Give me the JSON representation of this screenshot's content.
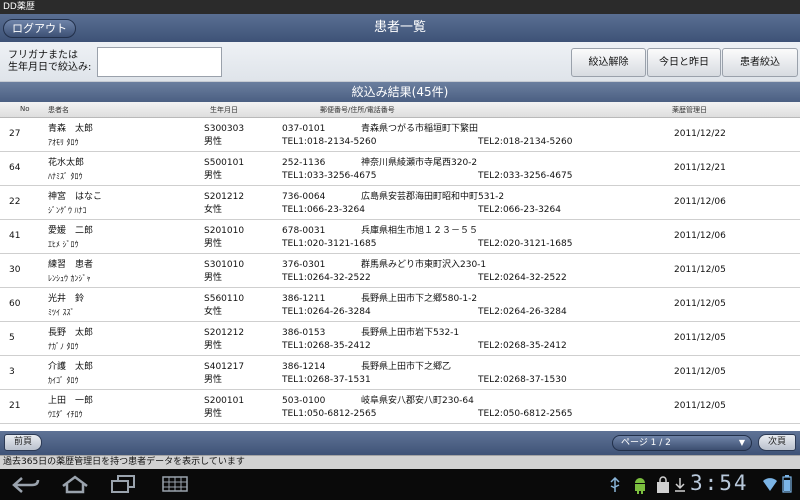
{
  "app": {
    "title": "DD薬歴"
  },
  "header": {
    "logout_label": "ログアウト",
    "title": "患者一覧"
  },
  "filter": {
    "label_line1": "フリガナまたは",
    "label_line2": "生年月日で絞込み:",
    "input_value": "",
    "clear_label": "絞込解除",
    "today_label": "今日と昨日",
    "filter_label": "患者絞込"
  },
  "result": {
    "title": "絞込み結果(45件)"
  },
  "columns": {
    "no": "No",
    "name": "患者名",
    "birth": "生年月日",
    "address": "郵便番号/住所/電話番号",
    "date": "薬歴管理日"
  },
  "patients": [
    {
      "no": "27",
      "name": "青森　太郎",
      "kana": "ｱｵﾓﾘ ﾀﾛｳ",
      "birth": "S300303",
      "sex": "男性",
      "zip": "037-0101",
      "address": "青森県つがる市稲垣町下繁田",
      "tel1": "TEL1:018-2134-5260",
      "tel2": "TEL2:018-2134-5260",
      "date": "2011/12/22"
    },
    {
      "no": "64",
      "name": "花水太郎",
      "kana": "ﾊﾅﾐｽﾞ ﾀﾛｳ",
      "birth": "S500101",
      "sex": "男性",
      "zip": "252-1136",
      "address": "神奈川県綾瀬市寺尾西320-2",
      "tel1": "TEL1:033-3256-4675",
      "tel2": "TEL2:033-3256-4675",
      "date": "2011/12/21"
    },
    {
      "no": "22",
      "name": "神宮　はなこ",
      "kana": "ｼﾞﾝｸﾞｳ ﾊﾅｺ",
      "birth": "S201212",
      "sex": "女性",
      "zip": "736-0064",
      "address": "広島県安芸郡海田町昭和中町531-2",
      "tel1": "TEL1:066-23-3264",
      "tel2": "TEL2:066-23-3264",
      "date": "2011/12/06"
    },
    {
      "no": "41",
      "name": "愛媛　二郎",
      "kana": "ｴﾋﾒ ｼﾞﾛｳ",
      "birth": "S201010",
      "sex": "男性",
      "zip": "678-0031",
      "address": "兵庫県相生市旭１２３－５５",
      "tel1": "TEL1:020-3121-1685",
      "tel2": "TEL2:020-3121-1685",
      "date": "2011/12/06"
    },
    {
      "no": "30",
      "name": "練習　患者",
      "kana": "ﾚﾝｼｭｳ ｶﾝｼﾞｬ",
      "birth": "S301010",
      "sex": "男性",
      "zip": "376-0301",
      "address": "群馬県みどり市東町沢入230-1",
      "tel1": "TEL1:0264-32-2522",
      "tel2": "TEL2:0264-32-2522",
      "date": "2011/12/05"
    },
    {
      "no": "60",
      "name": "光井　鈴",
      "kana": "ﾐﾂｲ ｽｽﾞ",
      "birth": "S560110",
      "sex": "女性",
      "zip": "386-1211",
      "address": "長野県上田市下之郷580-1-2",
      "tel1": "TEL1:0264-26-3284",
      "tel2": "TEL2:0264-26-3284",
      "date": "2011/12/05"
    },
    {
      "no": "5",
      "name": "長野　太郎",
      "kana": "ﾅｶﾞﾉ ﾀﾛｳ",
      "birth": "S201212",
      "sex": "男性",
      "zip": "386-0153",
      "address": "長野県上田市岩下532-1",
      "tel1": "TEL1:0268-35-2412",
      "tel2": "TEL2:0268-35-2412",
      "date": "2011/12/05"
    },
    {
      "no": "3",
      "name": "介護　太郎",
      "kana": "ｶｲｺﾞ ﾀﾛｳ",
      "birth": "S401217",
      "sex": "男性",
      "zip": "386-1214",
      "address": "長野県上田市下之郷乙",
      "tel1": "TEL1:0268-37-1531",
      "tel2": "TEL2:0268-37-1530",
      "date": "2011/12/05"
    },
    {
      "no": "21",
      "name": "上田　一郎",
      "kana": "ｳｴﾀﾞ ｲﾁﾛｳ",
      "birth": "S200101",
      "sex": "男性",
      "zip": "503-0100",
      "address": "岐阜県安八郡安八町230-64",
      "tel1": "TEL1:050-6812-2565",
      "tel2": "TEL2:050-6812-2565",
      "date": "2011/12/05"
    }
  ],
  "pager": {
    "prev_label": "前頁",
    "page_label": "ページ 1 / 2",
    "next_label": "次頁"
  },
  "status": {
    "text": "過去365日の薬歴管理日を持つ患者データを表示しています"
  },
  "system": {
    "clock": "3:54",
    "icons": [
      "back-icon",
      "home-icon",
      "recent-apps-icon",
      "menu-grid-icon",
      "usb-icon",
      "android-debug-icon",
      "bag-icon",
      "download-icon",
      "wifi-icon",
      "battery-icon"
    ]
  }
}
